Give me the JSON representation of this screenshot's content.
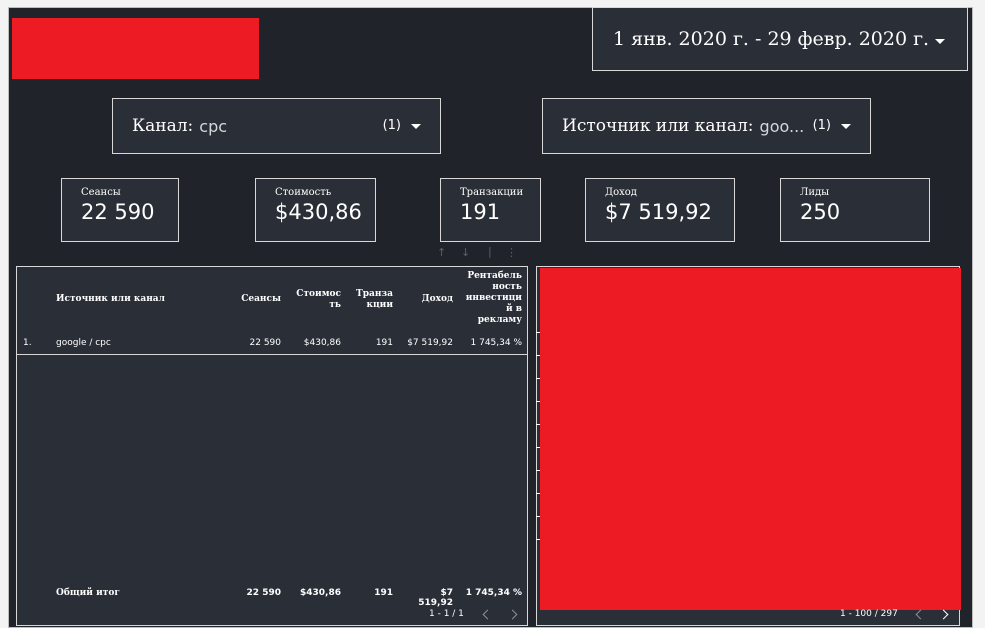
{
  "date_range": {
    "label": "1 янв. 2020 г. - 29 февр. 2020 г."
  },
  "filters": [
    {
      "label": "Канал:",
      "value": "cpc",
      "count": "(1)"
    },
    {
      "label": "Источник или канал:",
      "value": "goo...",
      "count": "(1)"
    }
  ],
  "kpis": [
    {
      "label": "Сеансы",
      "value": "22 590"
    },
    {
      "label": "Стоимость",
      "value": "$430,86"
    },
    {
      "label": "Транзакции",
      "value": "191"
    },
    {
      "label": "Доход",
      "value": "$7 519,92"
    },
    {
      "label": "Лиды",
      "value": "250"
    }
  ],
  "table": {
    "headers": {
      "source": "Источник или канал",
      "sessions": "Сеансы",
      "cost": [
        "Стоимос",
        "ть"
      ],
      "transactions": [
        "Транза",
        "кции"
      ],
      "revenue": "Доход",
      "roi": [
        "Рентабель",
        "ность",
        "инвестици",
        "й в",
        "рекламу"
      ]
    },
    "rows": [
      {
        "index": "1.",
        "source": "google / cpc",
        "sessions": "22 590",
        "cost": "$430,86",
        "transactions": "191",
        "revenue": "$7 519,92",
        "roi": "1 745,34 %"
      }
    ],
    "total": {
      "label": "Общий итог",
      "sessions": "22 590",
      "cost": "$430,86",
      "transactions": "191",
      "revenue": "$7 519,92",
      "roi": "1 745,34 %"
    },
    "pagination": "1 - 1 / 1"
  },
  "right_table": {
    "pagination": "1 - 100 / 297"
  },
  "toolbar_icons": [
    "sort-up-icon",
    "sort-down-icon",
    "more-vert-icon"
  ],
  "colors": {
    "background": "#202329",
    "panel": "#2a2e37",
    "redaction": "#ed1c24",
    "text": "#ffffff"
  }
}
